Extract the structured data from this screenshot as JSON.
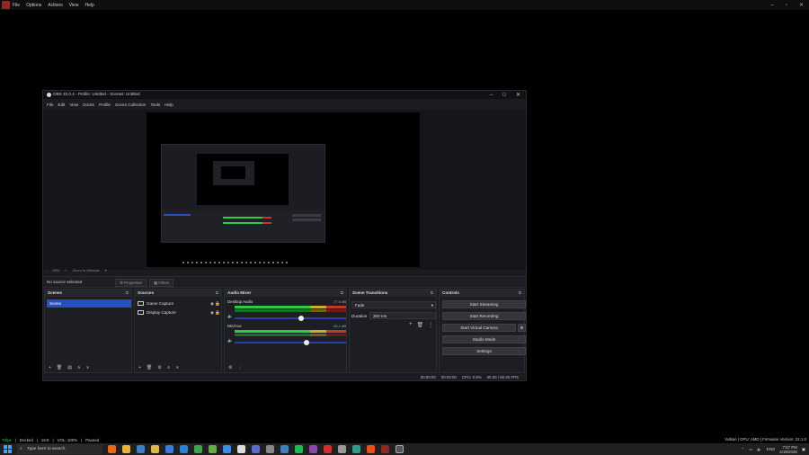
{
  "top_menu": [
    "File",
    "Options",
    "Actions",
    "View",
    "Help"
  ],
  "obs": {
    "title": "OBS 32.0.4 - Profile: Untitled - Scenes: Untitled",
    "menu": [
      "File",
      "Edit",
      "View",
      "Docks",
      "Profile",
      "Scene Collection",
      "Tools",
      "Help"
    ],
    "zoom": "33%",
    "zoom_fit": "Zoom to Window",
    "no_source": "No source selected",
    "properties": "Properties",
    "filters": "Filters",
    "docks": {
      "scenes": {
        "title": "Scenes",
        "items": [
          "Scene"
        ]
      },
      "sources": {
        "title": "Sources",
        "items": [
          "Game Capture",
          "Display Capture"
        ]
      },
      "mixer": {
        "title": "Audio Mixer",
        "channels": [
          {
            "name": "Desktop Audio",
            "db": "-77.5 dB"
          },
          {
            "name": "Mic/Aux",
            "db": "-54.1 dB"
          }
        ]
      },
      "transitions": {
        "title": "Scene Transitions",
        "type": "Fade",
        "duration_label": "Duration",
        "duration": "300 ms"
      },
      "controls": {
        "title": "Controls",
        "buttons": [
          "Start Streaming",
          "Start Recording",
          "Start Virtual Camera",
          "Studio Mode",
          "Settings"
        ]
      }
    },
    "status": {
      "stream": "00:00:00",
      "rec": "00:00:00",
      "cpu": "CPU: 0.9%",
      "fps": "60.00 / 60.00 FPS"
    }
  },
  "statusline": {
    "fps": "75fps",
    "docked": "Docked",
    "ratio": "16:9",
    "vol": "VOL: 100%",
    "paused": "Paused",
    "right": "Vulkan | GPU: AMD | Firmware Version: 22.1.0"
  },
  "taskbar": {
    "search_placeholder": "Type here to search",
    "lang": "ENG",
    "time": "7:57 PM",
    "date": "4/18/2026"
  }
}
